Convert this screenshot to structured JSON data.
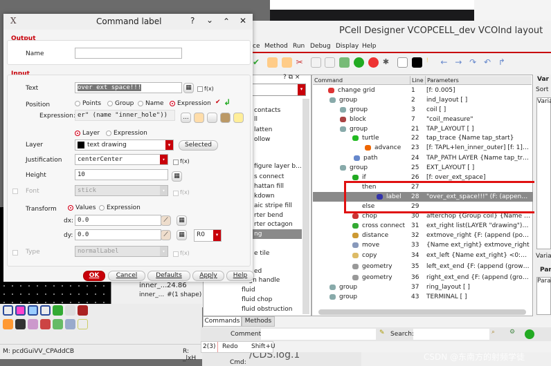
{
  "dialog": {
    "title": "Command label",
    "title_buttons": [
      "?",
      "⌄",
      "⌃",
      "✕"
    ],
    "output_label": "Output",
    "name_label": "Name",
    "name_value": "",
    "input_label": "Input",
    "text_label": "Text",
    "text_value": "over ext space!!!",
    "fx": "f(x)",
    "position_label": "Position",
    "position_options": [
      "Points",
      "Group",
      "Name",
      "Expression"
    ],
    "position_selected": "Expression",
    "expression_label": "Expression:",
    "expression_value": "er\" (name \"inner_hole\"))",
    "expr_more": "...",
    "layer_mode_options": [
      "Layer",
      "Expression"
    ],
    "layer_label": "Layer",
    "layer_value": "text drawing",
    "selected_button": "Selected",
    "justification_label": "Justification",
    "justification_value": "centerCenter",
    "height_label": "Height",
    "height_value": "10",
    "font_label": "Font",
    "font_value": "stick",
    "transform_label": "Transform",
    "transform_options": [
      "Values",
      "Expression"
    ],
    "dx_label": "dx:",
    "dx_value": "0.0",
    "dy_label": "dy:",
    "dy_value": "0.0",
    "rotation_value": "R0",
    "type_label": "Type",
    "type_value": "normalLabel",
    "buttons": {
      "ok": "OK",
      "cancel": "Cancel",
      "defaults": "Defaults",
      "apply": "Apply",
      "help": "Help"
    }
  },
  "main": {
    "title": "PCell Designer VCOPCELL_dev VCOInd layout",
    "menu": [
      "ce",
      "Method",
      "Run",
      "Debug",
      "Display",
      "Help"
    ],
    "columns": {
      "command": "Command",
      "line": "Line",
      "params": "Parameters"
    },
    "rows": [
      {
        "cmd": "change grid",
        "line": "1",
        "params": "[f: 0.005]",
        "icon": "grid-icon"
      },
      {
        "cmd": "group",
        "line": "2",
        "params": "ind_layout [ ]",
        "icon": "group-icon"
      },
      {
        "cmd": "group",
        "line": "3",
        "params": "coil [ ]",
        "icon": "group-icon"
      },
      {
        "cmd": "block",
        "line": "7",
        "params": "\"coil_measure\"",
        "icon": "block-icon"
      },
      {
        "cmd": "group",
        "line": "21",
        "params": "TAP_LAYOUT [ ]",
        "icon": "group-icon"
      },
      {
        "cmd": "turtle",
        "line": "22",
        "params": "tap_trace {Name tap_start}",
        "icon": "turtle-icon"
      },
      {
        "cmd": "advance",
        "line": "23",
        "params": "[f: TAPL+len_inner_outer] [f: 1] d...",
        "icon": "arrow-up-icon"
      },
      {
        "cmd": "path",
        "line": "24",
        "params": "TAP_PATH LAYER {Name tap_tra...",
        "icon": "path-icon"
      },
      {
        "cmd": "group",
        "line": "25",
        "params": "EXT_LAYOUT [ ]",
        "icon": "group-icon"
      },
      {
        "cmd": "if",
        "line": "26",
        "params": "[f: over_ext_space]",
        "icon": "question-icon"
      },
      {
        "cmd": "then",
        "line": "27",
        "params": "",
        "icon": ""
      },
      {
        "cmd": "label",
        "line": "28",
        "params": "\"over_ext_space!!!\" (F: (append (...",
        "icon": "label-icon"
      },
      {
        "cmd": "else",
        "line": "29",
        "params": "",
        "icon": ""
      },
      {
        "cmd": "chop",
        "line": "30",
        "params": "afterchop {Group coil} {Name ch...",
        "icon": "chop-icon"
      },
      {
        "cmd": "cross connect",
        "line": "31",
        "params": "ext_right list(LAYER \"drawing\") [f:...",
        "icon": "cross-connect-icon"
      },
      {
        "cmd": "distance",
        "line": "32",
        "params": "extmove_right {F: (append (point...",
        "icon": "distance-icon"
      },
      {
        "cmd": "move",
        "line": "33",
        "params": "{Name ext_right} extmove_right",
        "icon": "move-icon"
      },
      {
        "cmd": "copy",
        "line": "34",
        "params": "ext_left {Name ext_right} <0:0 M...",
        "icon": "copy-icon"
      },
      {
        "cmd": "geometry",
        "line": "35",
        "params": "left_ext_end {F: (append (grow (e...",
        "icon": "geometry-icon"
      },
      {
        "cmd": "geometry",
        "line": "36",
        "params": "right_ext_end {F: (append (grow (...",
        "icon": "geometry-icon"
      },
      {
        "cmd": "group",
        "line": "37",
        "params": "ring_layout [ ]",
        "icon": "group-icon"
      },
      {
        "cmd": "group",
        "line": "43",
        "params": "TERMINAL [ ]",
        "icon": "group-icon"
      }
    ],
    "selected_row": "label",
    "left_list": [
      "contacts",
      "ll",
      "latten",
      "ollow",
      "figure layer b...",
      "s connect",
      "hattan fill",
      "kdown",
      "aic stripe fill",
      "rter bend",
      "rter octagon",
      "ng",
      "e tile",
      "ed",
      "assign handle",
      "fluid",
      "fluid chop",
      "fluid obstruction"
    ],
    "left_panel_buttons": "? ⧉ ×",
    "tabs": [
      "Commands",
      "Methods"
    ],
    "comment_label": "Comment:",
    "search_label": "Search:",
    "undo": {
      "count": "2(3)",
      "action": "Redo",
      "shortcut": "Shift+U"
    },
    "right": {
      "vars_header": "Var",
      "sort": "Sort",
      "var_col": "Varia",
      "var_tab": "Varia",
      "par_header": "Par",
      "par_col": "Para"
    }
  },
  "background": {
    "status_left": "M: pcdGuiVV_CPAddCB",
    "status_right": "R: _lxH",
    "var_name": "inner_...",
    "var_value": "24.86",
    "var_name2": "inner_...",
    "var_value2": "#(1 shape)",
    "log_title": "/CDS.log.1",
    "cmd_label": "Cmd:"
  },
  "watermark": "CSDN @东南方的射频学徒",
  "colors": {
    "accent": "#c8000a",
    "highlight_box": "#e01010",
    "selected_row": "#8a8a8a"
  }
}
